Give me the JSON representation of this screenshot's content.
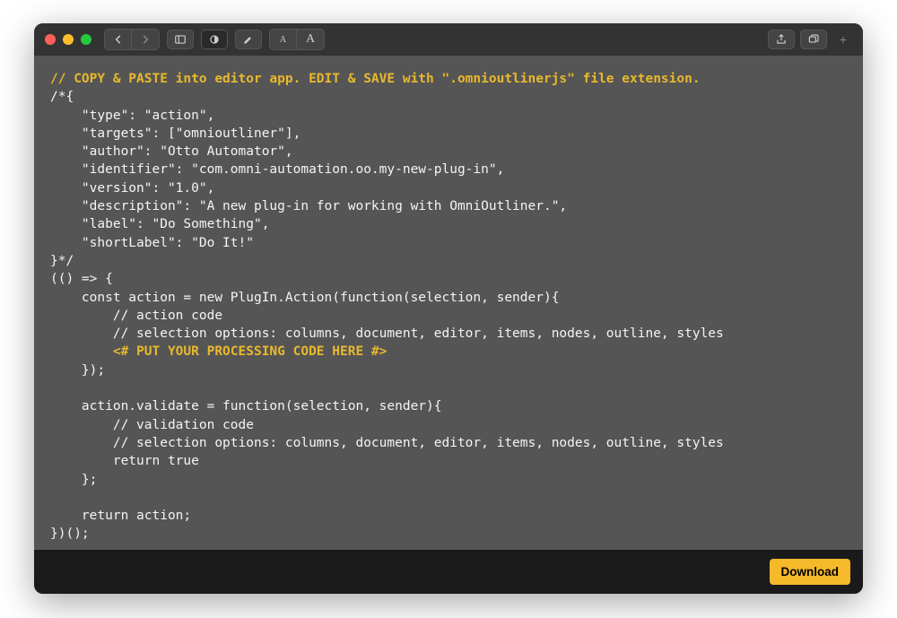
{
  "code": {
    "comment_header": "// COPY & PASTE into editor app. EDIT & SAVE with \".omnioutlinerjs\" file extension.",
    "meta_open": "/*{",
    "meta_type": "    \"type\": \"action\",",
    "meta_targets": "    \"targets\": [\"omnioutliner\"],",
    "meta_author": "    \"author\": \"Otto Automator\",",
    "meta_identifier": "    \"identifier\": \"com.omni-automation.oo.my-new-plug-in\",",
    "meta_version": "    \"version\": \"1.0\",",
    "meta_description": "    \"description\": \"A new plug-in for working with OmniOutliner.\",",
    "meta_label": "    \"label\": \"Do Something\",",
    "meta_shortLabel": "    \"shortLabel\": \"Do It!\"",
    "meta_close": "}*/",
    "iife_open": "(() => {",
    "action_decl": "    const action = new PlugIn.Action(function(selection, sender){",
    "action_comment1": "        // action code",
    "action_comment2": "        // selection options: columns, document, editor, items, nodes, outline, styles",
    "placeholder": "        <# PUT YOUR PROCESSING CODE HERE #>",
    "action_close": "    });",
    "blank1": "",
    "validate_decl": "    action.validate = function(selection, sender){",
    "validate_comment1": "        // validation code",
    "validate_comment2": "        // selection options: columns, document, editor, items, nodes, outline, styles",
    "validate_return": "        return true",
    "validate_close": "    };",
    "blank2": "    ",
    "return_stmt": "    return action;",
    "iife_close": "})();"
  },
  "footer": {
    "download_label": "Download"
  }
}
